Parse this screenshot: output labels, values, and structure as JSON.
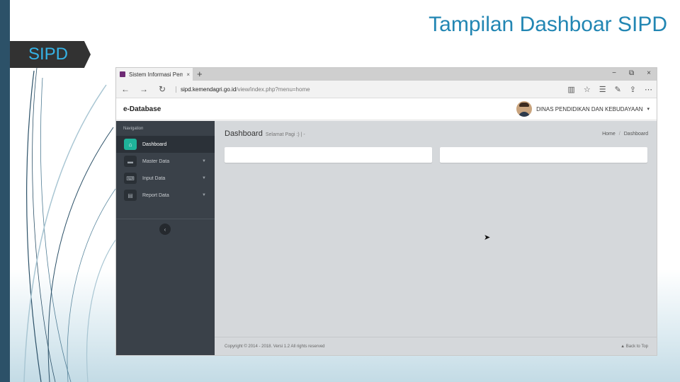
{
  "slide": {
    "title": "Tampilan Dashboar SIPD",
    "section_tag": "SIPD",
    "colors": {
      "title": "#2286b3",
      "tag_bg": "#323232",
      "tag_text": "#35b3e6",
      "left_bar": "#2c5168"
    }
  },
  "browser": {
    "tab_title": "Sistem Informasi Pemba",
    "tab_close": "×",
    "new_tab": "+",
    "win_controls": [
      "−",
      "⧉",
      "×"
    ],
    "nav": {
      "back": "←",
      "forward": "→",
      "refresh": "↻"
    },
    "url_host": "sipd.kemendagri.go.id",
    "url_path": "/view/index.php?menu=home",
    "toolbar_icons": [
      "reading-view-icon",
      "star-icon",
      "hub-icon",
      "note-icon",
      "share-icon",
      "more-icon"
    ]
  },
  "app": {
    "brand": "e-Database",
    "user_name": "DINAS PENDIDIKAN DAN KEBUDAYAAN",
    "user_caret": "▾",
    "sidebar": {
      "heading": "Navigation",
      "items": [
        {
          "label": "Dashboard",
          "icon": "home-icon",
          "active": true
        },
        {
          "label": "Master Data",
          "icon": "folder-icon",
          "active": false
        },
        {
          "label": "Input Data",
          "icon": "keyboard-icon",
          "active": false
        },
        {
          "label": "Report Data",
          "icon": "file-icon",
          "active": false
        }
      ],
      "arrow": "▼",
      "collapse": "‹"
    },
    "content": {
      "page_title": "Dashboard",
      "page_subtitle": "Selamat Pagi :) | -",
      "breadcrumb": [
        "Home",
        "Dashboard"
      ],
      "breadcrumb_sep": "/",
      "footer_copyright": "Copyright © 2014 - 2018. Versi 1.2 All rights reserved",
      "footer_back_to_top": "▲ Back to Top"
    }
  }
}
